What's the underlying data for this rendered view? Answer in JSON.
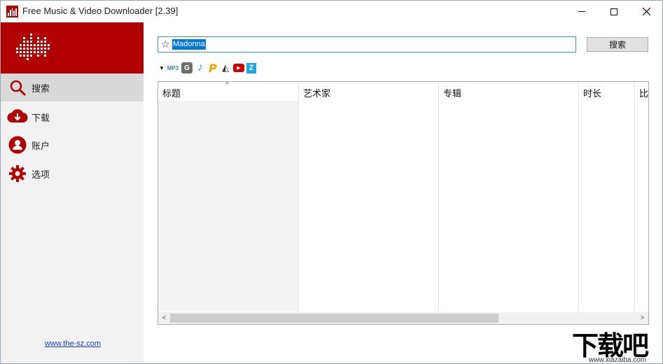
{
  "window": {
    "title": "Free Music & Video Downloader [2.39]",
    "accent_color": "#b20000"
  },
  "sidebar": {
    "items": [
      {
        "label": "搜索",
        "icon": "search-icon",
        "active": true
      },
      {
        "label": "下载",
        "icon": "download-icon",
        "active": false
      },
      {
        "label": "账户",
        "icon": "account-icon",
        "active": false
      },
      {
        "label": "选项",
        "icon": "gear-icon",
        "active": false
      }
    ],
    "link": "www.the-sz.com"
  },
  "search": {
    "value": "Madonna",
    "button_label": "搜索"
  },
  "sources": {
    "mp3_label": "MP3",
    "items": [
      "dropdown-icon",
      "mp3-source-icon",
      "g-source-icon",
      "note-source-icon",
      "p-source-icon",
      "soundcloud-source-icon",
      "youtube-source-icon",
      "z-source-icon"
    ]
  },
  "results": {
    "columns": [
      "标题",
      "艺术家",
      "专辑",
      "时长",
      "比"
    ],
    "sort_indicator": "^",
    "rows": []
  },
  "scrollbar": {
    "left_arrow": "<",
    "right_arrow": ">"
  },
  "watermark": {
    "text": "下载吧",
    "url": "www.xiazaiba.com"
  }
}
